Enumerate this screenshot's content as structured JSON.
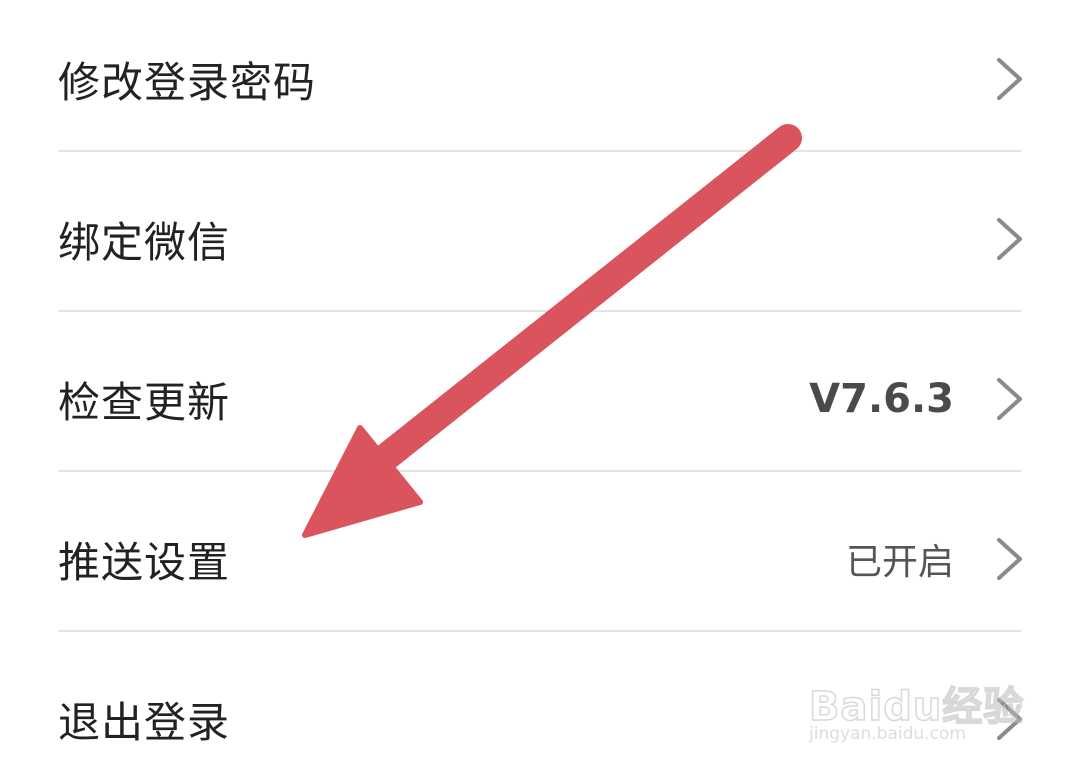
{
  "settings": {
    "items": [
      {
        "label": "修改登录密码",
        "value": ""
      },
      {
        "label": "绑定微信",
        "value": ""
      },
      {
        "label": "检查更新",
        "value": "V7.6.3"
      },
      {
        "label": "推送设置",
        "value": "已开启"
      },
      {
        "label": "退出登录",
        "value": ""
      }
    ]
  },
  "annotation": {
    "arrow_color": "#d9545c",
    "points_to": "推送设置"
  },
  "watermark": {
    "brand": "Baidu经验",
    "url": "jingyan.baidu.com"
  },
  "icons": {
    "row_trailing": "chevron-right-icon",
    "annotation": "red-arrow-icon"
  }
}
